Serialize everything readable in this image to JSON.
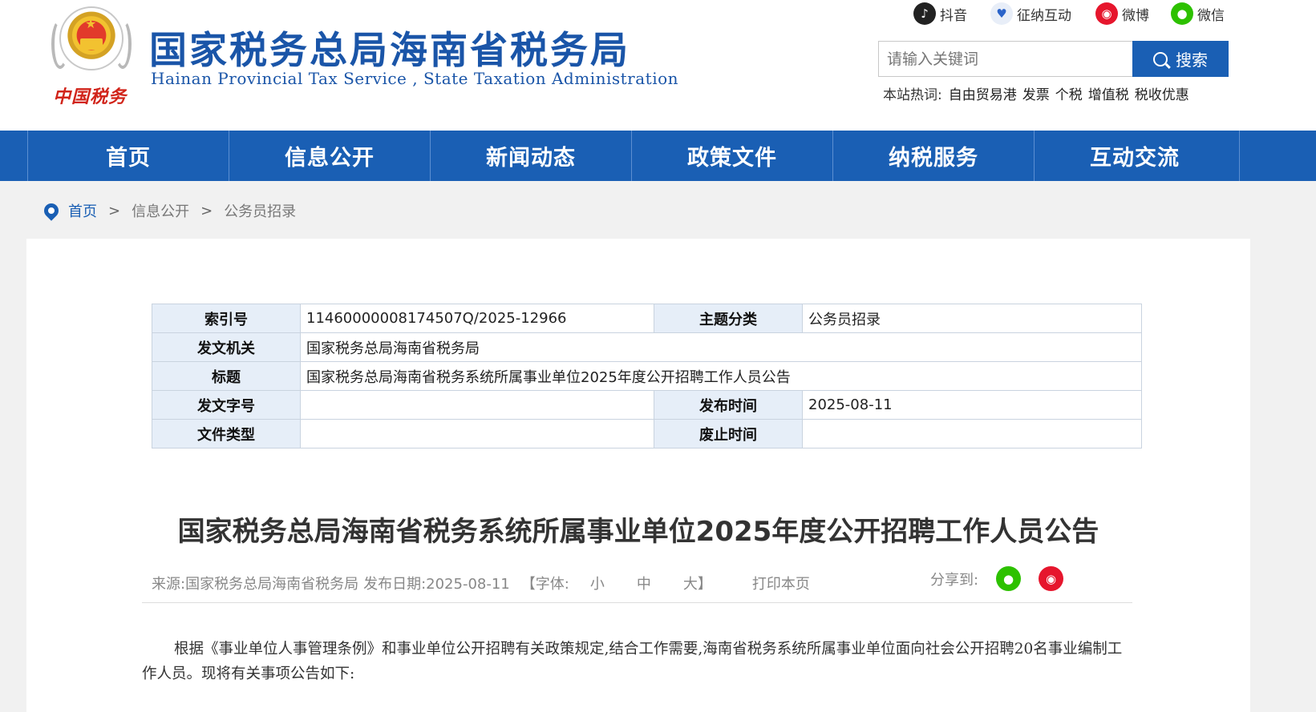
{
  "header": {
    "title_cn": "国家税务总局海南省税务局",
    "title_en": "Hainan  Provincial  Tax  Service ,  State  Taxation  Administration",
    "seal_text": "中国税务",
    "social": [
      {
        "label": "抖音",
        "icon": "douyin-icon"
      },
      {
        "label": "征纳互动",
        "icon": "zhengna-icon"
      },
      {
        "label": "微博",
        "icon": "weibo-icon"
      },
      {
        "label": "微信",
        "icon": "wechat-icon"
      }
    ],
    "search": {
      "placeholder": "请输入关键词",
      "button_label": "搜索"
    },
    "hot": {
      "label": "本站热词:",
      "items": [
        "自由贸易港",
        "发票",
        "个税",
        "增值税",
        "税收优惠"
      ]
    }
  },
  "nav": {
    "items": [
      "首页",
      "信息公开",
      "新闻动态",
      "政策文件",
      "纳税服务",
      "互动交流"
    ]
  },
  "breadcrumb": {
    "home": "首页",
    "sep": ">",
    "items": [
      "信息公开",
      "公务员招录"
    ]
  },
  "meta": {
    "index_label": "索引号",
    "index_value": "11460000008174507Q/2025-12966",
    "category_label": "主题分类",
    "category_value": "公务员招录",
    "issuer_label": "发文机关",
    "issuer_value": "国家税务总局海南省税务局",
    "title_label": "标题",
    "title_value": "国家税务总局海南省税务系统所属事业单位2025年度公开招聘工作人员公告",
    "docno_label": "发文字号",
    "docno_value": "",
    "pubdate_label": "发布时间",
    "pubdate_value": "2025-08-11",
    "doctype_label": "文件类型",
    "doctype_value": "",
    "expire_label": "废止时间",
    "expire_value": ""
  },
  "article": {
    "title": "国家税务总局海南省税务系统所属事业单位2025年度公开招聘工作人员公告",
    "source": "来源:国家税务总局海南省税务局",
    "date": "发布日期:2025-08-11",
    "font_label": "【字体:",
    "font_small": "小",
    "font_medium": "中",
    "font_large": "大】",
    "print": "打印本页",
    "share_label": "分享到:",
    "body": "根据《事业单位人事管理条例》和事业单位公开招聘有关政策规定,结合工作需要,海南省税务系统所属事业单位面向社会公开招聘20名事业编制工作人员。现将有关事项公告如下:"
  },
  "colors": {
    "brand_blue": "#1a5fb4",
    "title_blue": "#1a55a8",
    "header_cell_bg": "#e6eef8",
    "wechat_green": "#2dc100",
    "weibo_red": "#e6162d"
  }
}
